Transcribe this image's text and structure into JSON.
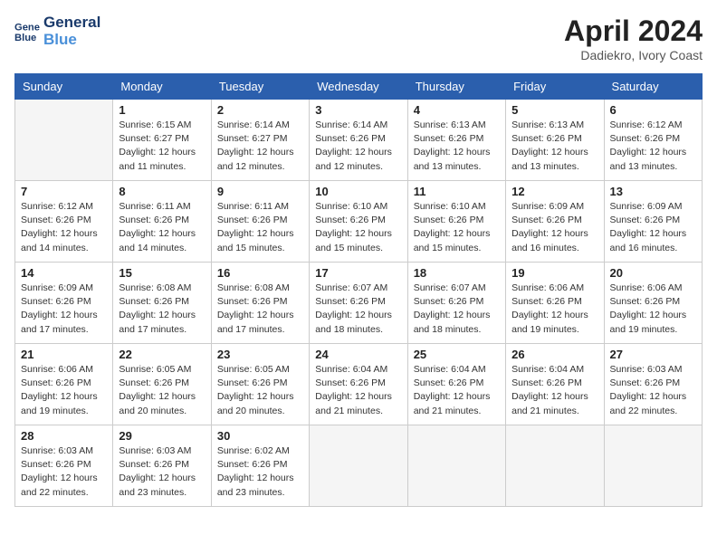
{
  "header": {
    "logo_line1": "General",
    "logo_line2": "Blue",
    "month_year": "April 2024",
    "location": "Dadiekro, Ivory Coast"
  },
  "weekdays": [
    "Sunday",
    "Monday",
    "Tuesday",
    "Wednesday",
    "Thursday",
    "Friday",
    "Saturday"
  ],
  "weeks": [
    [
      {
        "day": "",
        "info": ""
      },
      {
        "day": "1",
        "info": "Sunrise: 6:15 AM\nSunset: 6:27 PM\nDaylight: 12 hours\nand 11 minutes."
      },
      {
        "day": "2",
        "info": "Sunrise: 6:14 AM\nSunset: 6:27 PM\nDaylight: 12 hours\nand 12 minutes."
      },
      {
        "day": "3",
        "info": "Sunrise: 6:14 AM\nSunset: 6:26 PM\nDaylight: 12 hours\nand 12 minutes."
      },
      {
        "day": "4",
        "info": "Sunrise: 6:13 AM\nSunset: 6:26 PM\nDaylight: 12 hours\nand 13 minutes."
      },
      {
        "day": "5",
        "info": "Sunrise: 6:13 AM\nSunset: 6:26 PM\nDaylight: 12 hours\nand 13 minutes."
      },
      {
        "day": "6",
        "info": "Sunrise: 6:12 AM\nSunset: 6:26 PM\nDaylight: 12 hours\nand 13 minutes."
      }
    ],
    [
      {
        "day": "7",
        "info": "Sunrise: 6:12 AM\nSunset: 6:26 PM\nDaylight: 12 hours\nand 14 minutes."
      },
      {
        "day": "8",
        "info": "Sunrise: 6:11 AM\nSunset: 6:26 PM\nDaylight: 12 hours\nand 14 minutes."
      },
      {
        "day": "9",
        "info": "Sunrise: 6:11 AM\nSunset: 6:26 PM\nDaylight: 12 hours\nand 15 minutes."
      },
      {
        "day": "10",
        "info": "Sunrise: 6:10 AM\nSunset: 6:26 PM\nDaylight: 12 hours\nand 15 minutes."
      },
      {
        "day": "11",
        "info": "Sunrise: 6:10 AM\nSunset: 6:26 PM\nDaylight: 12 hours\nand 15 minutes."
      },
      {
        "day": "12",
        "info": "Sunrise: 6:09 AM\nSunset: 6:26 PM\nDaylight: 12 hours\nand 16 minutes."
      },
      {
        "day": "13",
        "info": "Sunrise: 6:09 AM\nSunset: 6:26 PM\nDaylight: 12 hours\nand 16 minutes."
      }
    ],
    [
      {
        "day": "14",
        "info": "Sunrise: 6:09 AM\nSunset: 6:26 PM\nDaylight: 12 hours\nand 17 minutes."
      },
      {
        "day": "15",
        "info": "Sunrise: 6:08 AM\nSunset: 6:26 PM\nDaylight: 12 hours\nand 17 minutes."
      },
      {
        "day": "16",
        "info": "Sunrise: 6:08 AM\nSunset: 6:26 PM\nDaylight: 12 hours\nand 17 minutes."
      },
      {
        "day": "17",
        "info": "Sunrise: 6:07 AM\nSunset: 6:26 PM\nDaylight: 12 hours\nand 18 minutes."
      },
      {
        "day": "18",
        "info": "Sunrise: 6:07 AM\nSunset: 6:26 PM\nDaylight: 12 hours\nand 18 minutes."
      },
      {
        "day": "19",
        "info": "Sunrise: 6:06 AM\nSunset: 6:26 PM\nDaylight: 12 hours\nand 19 minutes."
      },
      {
        "day": "20",
        "info": "Sunrise: 6:06 AM\nSunset: 6:26 PM\nDaylight: 12 hours\nand 19 minutes."
      }
    ],
    [
      {
        "day": "21",
        "info": "Sunrise: 6:06 AM\nSunset: 6:26 PM\nDaylight: 12 hours\nand 19 minutes."
      },
      {
        "day": "22",
        "info": "Sunrise: 6:05 AM\nSunset: 6:26 PM\nDaylight: 12 hours\nand 20 minutes."
      },
      {
        "day": "23",
        "info": "Sunrise: 6:05 AM\nSunset: 6:26 PM\nDaylight: 12 hours\nand 20 minutes."
      },
      {
        "day": "24",
        "info": "Sunrise: 6:04 AM\nSunset: 6:26 PM\nDaylight: 12 hours\nand 21 minutes."
      },
      {
        "day": "25",
        "info": "Sunrise: 6:04 AM\nSunset: 6:26 PM\nDaylight: 12 hours\nand 21 minutes."
      },
      {
        "day": "26",
        "info": "Sunrise: 6:04 AM\nSunset: 6:26 PM\nDaylight: 12 hours\nand 21 minutes."
      },
      {
        "day": "27",
        "info": "Sunrise: 6:03 AM\nSunset: 6:26 PM\nDaylight: 12 hours\nand 22 minutes."
      }
    ],
    [
      {
        "day": "28",
        "info": "Sunrise: 6:03 AM\nSunset: 6:26 PM\nDaylight: 12 hours\nand 22 minutes."
      },
      {
        "day": "29",
        "info": "Sunrise: 6:03 AM\nSunset: 6:26 PM\nDaylight: 12 hours\nand 23 minutes."
      },
      {
        "day": "30",
        "info": "Sunrise: 6:02 AM\nSunset: 6:26 PM\nDaylight: 12 hours\nand 23 minutes."
      },
      {
        "day": "",
        "info": ""
      },
      {
        "day": "",
        "info": ""
      },
      {
        "day": "",
        "info": ""
      },
      {
        "day": "",
        "info": ""
      }
    ]
  ]
}
